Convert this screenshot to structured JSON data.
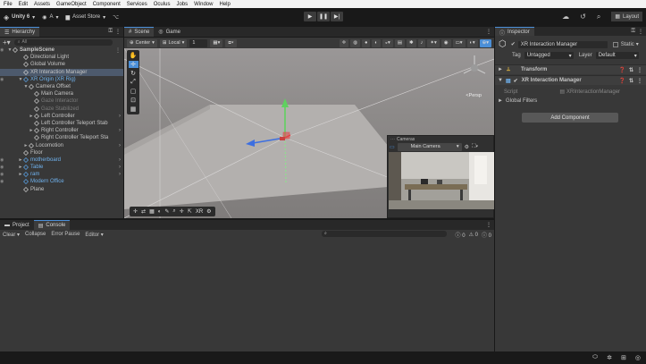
{
  "menu": [
    "File",
    "Edit",
    "Assets",
    "GameObject",
    "Component",
    "Services",
    "Oculus",
    "Jobs",
    "Window",
    "Help"
  ],
  "toolbar": {
    "account": "Unity 6",
    "user": "A",
    "asset_store": "Asset Store",
    "layout": "Layout"
  },
  "hierarchy": {
    "tab": "Hierarchy",
    "search_placeholder": "All",
    "rows": [
      {
        "label": "SampleScene",
        "indent": 0,
        "arrow": "▼",
        "icon": "scene"
      },
      {
        "label": "Directional Light",
        "indent": 2
      },
      {
        "label": "Global Volume",
        "indent": 2
      },
      {
        "label": "XR Interaction Manager",
        "indent": 2,
        "selected": true
      },
      {
        "label": "XR Origin (XR Rig)",
        "indent": 2,
        "arrow": "▼",
        "blue": true
      },
      {
        "label": "Camera Offset",
        "indent": 3,
        "arrow": "▼"
      },
      {
        "label": "Main Camera",
        "indent": 4
      },
      {
        "label": "Gaze Interactor",
        "indent": 4,
        "dim": true
      },
      {
        "label": "Gaze Stabilized",
        "indent": 4,
        "dim": true
      },
      {
        "label": "Left Controller",
        "indent": 4,
        "arrow": "►"
      },
      {
        "label": "Left Controller Teleport Stab",
        "indent": 4
      },
      {
        "label": "Right Controller",
        "indent": 4,
        "arrow": "►"
      },
      {
        "label": "Right Controller Teleport Sta",
        "indent": 4
      },
      {
        "label": "Locomotion",
        "indent": 3,
        "arrow": "►"
      },
      {
        "label": "Floor",
        "indent": 2
      },
      {
        "label": "motherboard",
        "indent": 2,
        "arrow": "►",
        "blue": true
      },
      {
        "label": "Table",
        "indent": 2,
        "arrow": "►",
        "blue": true
      },
      {
        "label": "ram",
        "indent": 2,
        "arrow": "►",
        "blue": true
      },
      {
        "label": "Modern Office",
        "indent": 2,
        "blue": true
      },
      {
        "label": "Plane",
        "indent": 2
      }
    ]
  },
  "scene": {
    "tabs": [
      "Scene",
      "Game"
    ],
    "pivot": "Center",
    "space": "Local",
    "snap": "1",
    "persp_label": "<Persp",
    "camera_overlay_title": "Cameras",
    "camera_select": "Main Camera",
    "bottom_tool_label": "XR"
  },
  "inspector": {
    "tab": "Inspector",
    "object_name": "XR Interaction Manager",
    "static_label": "Static",
    "tag_label": "Tag",
    "tag_value": "Untagged",
    "layer_label": "Layer",
    "layer_value": "Default",
    "transform": "Transform",
    "component": "XR Interaction Manager",
    "script_label": "Script",
    "script_value": "XRInteractionManager",
    "global_filters": "Global Filters",
    "add_component": "Add Component"
  },
  "console": {
    "tabs": [
      "Project",
      "Console"
    ],
    "clear": "Clear",
    "collapse": "Collapse",
    "error_pause": "Error Pause",
    "editor": "Editor",
    "counts": [
      "0",
      "0",
      "0"
    ]
  },
  "colors": {
    "accent": "#4b8fd8",
    "selected": "#4d5a6d",
    "prefab_blue": "#6fb2ee"
  }
}
